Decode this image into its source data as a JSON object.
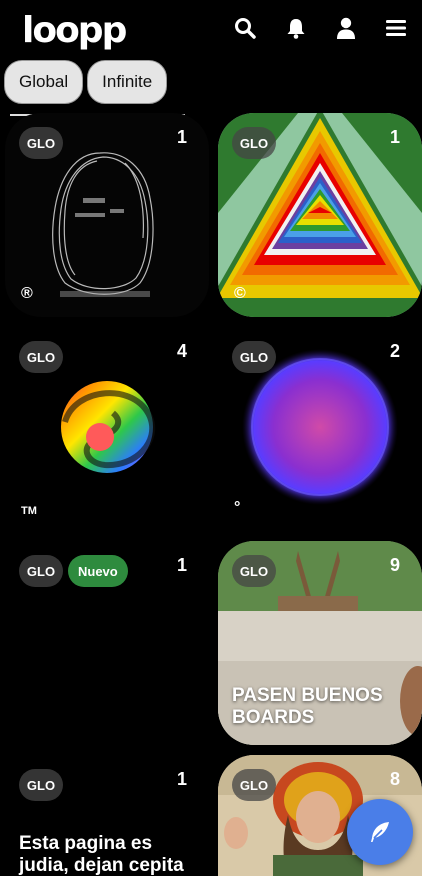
{
  "header": {
    "logo": "loopp",
    "icons": [
      "search-icon",
      "bell-icon",
      "user-icon",
      "menu-icon"
    ]
  },
  "tabs": [
    {
      "label": "Global"
    },
    {
      "label": "Infinite"
    }
  ],
  "cards": [
    {
      "badge": "GLO",
      "count": "1",
      "mark": "®"
    },
    {
      "badge": "GLO",
      "count": "1",
      "mark": "©"
    },
    {
      "badge": "GLO",
      "count": "4",
      "mark": "TM"
    },
    {
      "badge": "GLO",
      "count": "2",
      "mark": "°"
    },
    {
      "badge": "GLO",
      "count": "1",
      "tag": "Nuevo"
    },
    {
      "badge": "GLO",
      "count": "9",
      "title": "PASEN BUENOS BOARDS"
    },
    {
      "badge": "GLO",
      "count": "1",
      "title": "Esta pagina es judia, dejan cepita"
    },
    {
      "badge": "GLO",
      "count": "8"
    }
  ],
  "fab": {
    "icon": "feather-icon"
  },
  "colors": {
    "fab": "#4a7ee8",
    "nuevo": "#2e8b3e",
    "tab_bg": "#e5e5e5"
  }
}
